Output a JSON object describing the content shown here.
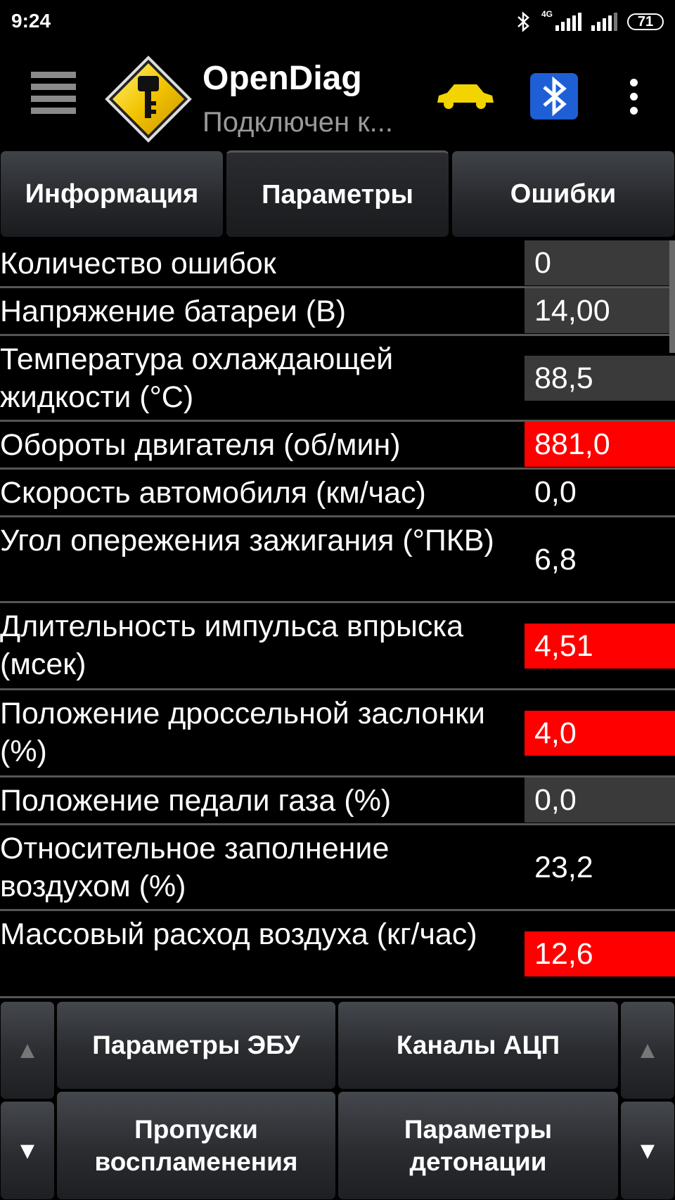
{
  "status_bar": {
    "time": "9:24",
    "network_type": "4G",
    "battery": "71"
  },
  "app_bar": {
    "title": "OpenDiag",
    "subtitle": "Подключен к..."
  },
  "tabs": [
    {
      "label": "Информация"
    },
    {
      "label": "Параметры"
    },
    {
      "label": "Ошибки"
    }
  ],
  "params": [
    {
      "label": "Количество ошибок",
      "value": "0",
      "status": "gray"
    },
    {
      "label": "Напряжение батареи (В)",
      "value": "14,00",
      "status": "gray"
    },
    {
      "label": "Температура охлаждающей жидкости (°С)",
      "value": "88,5",
      "status": "gray"
    },
    {
      "label": "Обороты двигателя (об/мин)",
      "value": "881,0",
      "status": "red"
    },
    {
      "label": "Скорость автомобиля (км/час)",
      "value": "0,0",
      "status": "none"
    },
    {
      "label": "Угол опережения зажигания (°ПКВ)",
      "value": "6,8",
      "status": "none"
    },
    {
      "label": "Длительность импульса впрыска (мсек)",
      "value": "4,51",
      "status": "red"
    },
    {
      "label": "Положение дроссельной заслонки (%)",
      "value": "4,0",
      "status": "red"
    },
    {
      "label": "Положение педали газа (%)",
      "value": "0,0",
      "status": "gray"
    },
    {
      "label": "Относительное заполнение воздухом (%)",
      "value": "23,2",
      "status": "none"
    },
    {
      "label": "Массовый расход воздуха (кг/час)",
      "value": "12,6",
      "status": "red"
    }
  ],
  "bottom": {
    "ecu_params": "Параметры ЭБУ",
    "adc_channels": "Каналы АЦП",
    "misfires": "Пропуски воспламенения",
    "knock_params": "Параметры детонации",
    "up_arrow": "▲",
    "down_arrow": "▼"
  },
  "colors": {
    "alert": "#ff0000",
    "neutral": "#3a3a3a",
    "car_icon": "#f2d400"
  }
}
